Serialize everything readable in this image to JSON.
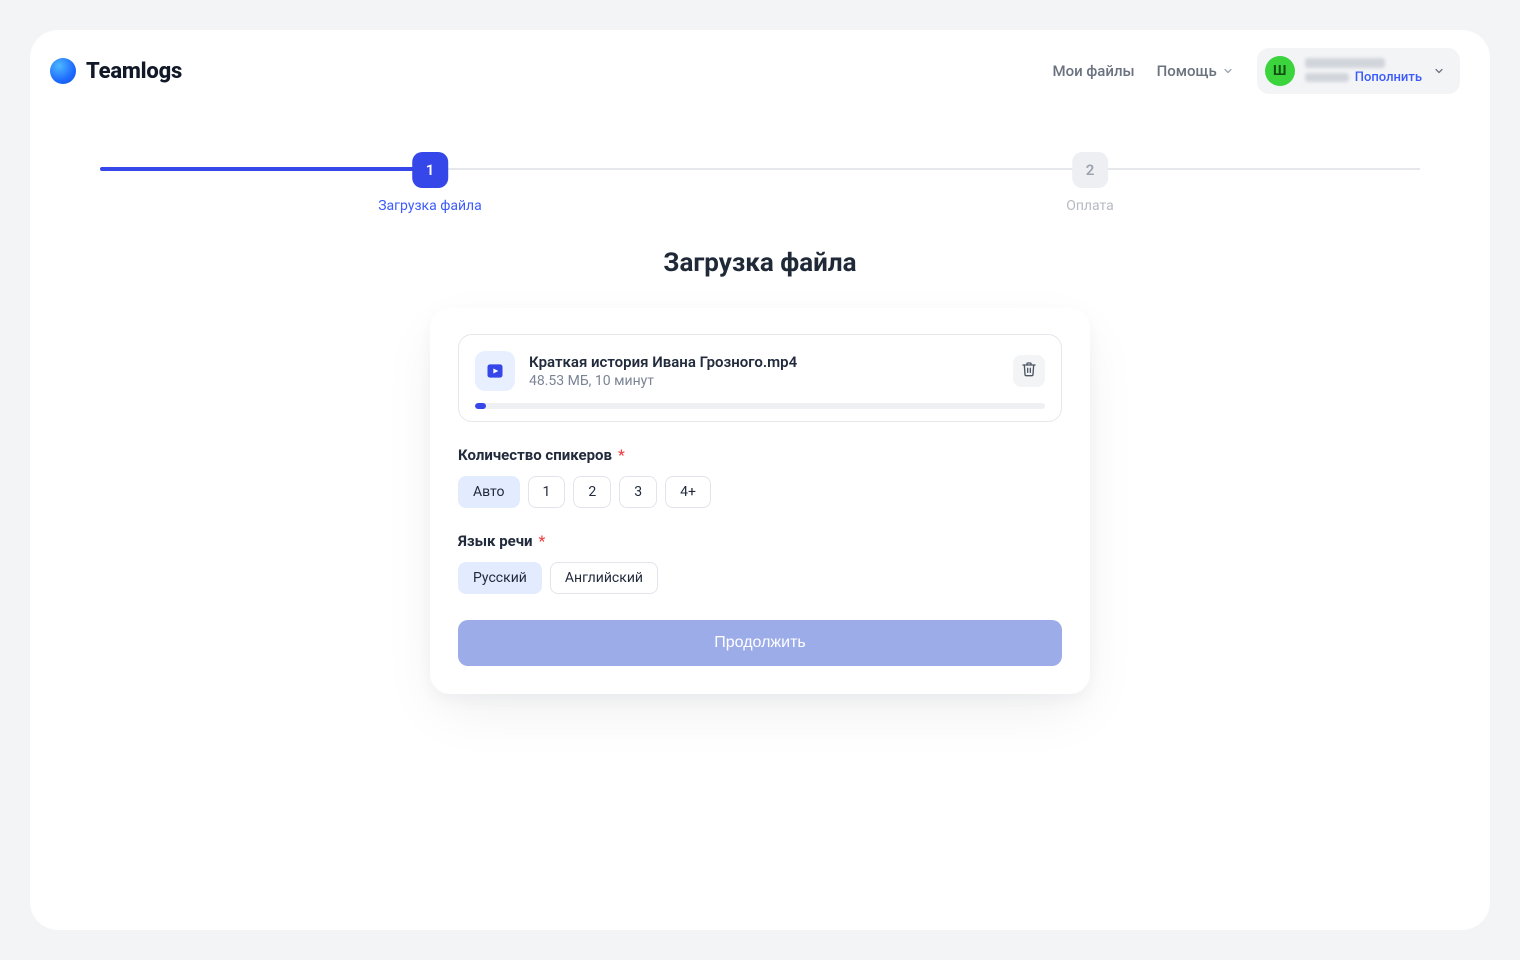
{
  "brand": {
    "name": "Teamlogs"
  },
  "header": {
    "my_files": "Мои файлы",
    "help": "Помощь",
    "topup": "Пополнить",
    "avatar_initial": "Ш"
  },
  "stepper": {
    "steps": [
      {
        "num": "1",
        "label": "Загрузка файла",
        "active": true,
        "pos_pct": 25
      },
      {
        "num": "2",
        "label": "Оплата",
        "active": false,
        "pos_pct": 75
      }
    ],
    "fill_pct": 25
  },
  "page": {
    "title": "Загрузка файла"
  },
  "file": {
    "name": "Краткая история Ивана Грозного.mp4",
    "meta": "48.53 МБ, 10 минут",
    "progress_pct": 2
  },
  "speakers": {
    "label": "Количество спикеров",
    "options": [
      {
        "label": "Авто",
        "selected": true
      },
      {
        "label": "1",
        "selected": false
      },
      {
        "label": "2",
        "selected": false
      },
      {
        "label": "3",
        "selected": false
      },
      {
        "label": "4+",
        "selected": false
      }
    ]
  },
  "language": {
    "label": "Язык речи",
    "options": [
      {
        "label": "Русский",
        "selected": true
      },
      {
        "label": "Английский",
        "selected": false
      }
    ]
  },
  "actions": {
    "continue": "Продолжить"
  },
  "required_mark": "*"
}
